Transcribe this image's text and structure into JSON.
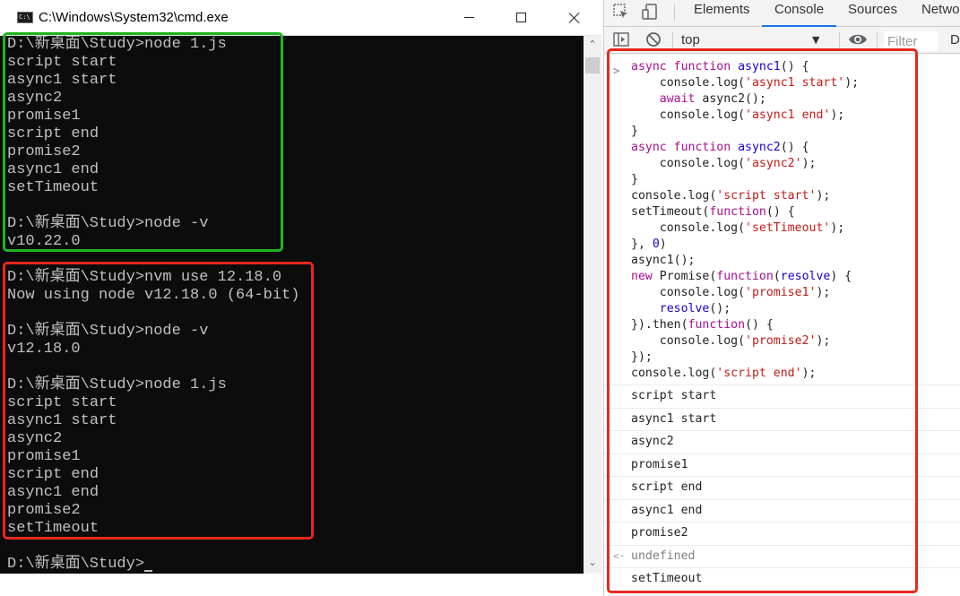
{
  "cmd_window": {
    "title": "C:\\Windows\\System32\\cmd.exe",
    "icon_label": "C:\\",
    "lines": [
      "D:\\新桌面\\Study>node 1.js",
      "script start",
      "async1 start",
      "async2",
      "promise1",
      "script end",
      "promise2",
      "async1 end",
      "setTimeout",
      "",
      "D:\\新桌面\\Study>node -v",
      "v10.22.0",
      "",
      "D:\\新桌面\\Study>nvm use 12.18.0",
      "Now using node v12.18.0 (64-bit)",
      "",
      "D:\\新桌面\\Study>node -v",
      "v12.18.0",
      "",
      "D:\\新桌面\\Study>node 1.js",
      "script start",
      "async1 start",
      "async2",
      "promise1",
      "script end",
      "async1 end",
      "promise2",
      "setTimeout",
      "",
      "D:\\新桌面\\Study>"
    ]
  },
  "devtools": {
    "tabs": [
      "Elements",
      "Console",
      "Sources",
      "Netwo"
    ],
    "active_tab": "Console",
    "toolbar": {
      "context": "top",
      "filter_placeholder": "Filter",
      "levels": "D"
    },
    "code_lines": [
      [
        [
          "kw",
          "async "
        ],
        [
          "kw",
          "function "
        ],
        [
          "fn",
          "async1"
        ],
        [
          "tok",
          "() {"
        ]
      ],
      [
        [
          "tok",
          "    console.log("
        ],
        [
          "str",
          "'async1 start'"
        ],
        [
          "tok",
          ");"
        ]
      ],
      [
        [
          "kw",
          "    await "
        ],
        [
          "tok",
          "async2();"
        ]
      ],
      [
        [
          "tok",
          "    console.log("
        ],
        [
          "str",
          "'async1 end'"
        ],
        [
          "tok",
          ");"
        ]
      ],
      [
        [
          "tok",
          "}"
        ]
      ],
      [
        [
          "kw",
          "async "
        ],
        [
          "kw",
          "function "
        ],
        [
          "fn",
          "async2"
        ],
        [
          "tok",
          "() {"
        ]
      ],
      [
        [
          "tok",
          "    console.log("
        ],
        [
          "str",
          "'async2'"
        ],
        [
          "tok",
          ");"
        ]
      ],
      [
        [
          "tok",
          "}"
        ]
      ],
      [
        [
          "tok",
          "console.log("
        ],
        [
          "str",
          "'script start'"
        ],
        [
          "tok",
          ");"
        ]
      ],
      [
        [
          "tok",
          "setTimeout("
        ],
        [
          "kw",
          "function"
        ],
        [
          "tok",
          "() {"
        ]
      ],
      [
        [
          "tok",
          "    console.log("
        ],
        [
          "str",
          "'setTimeout'"
        ],
        [
          "tok",
          ");"
        ]
      ],
      [
        [
          "tok",
          "}, "
        ],
        [
          "num",
          "0"
        ],
        [
          "tok",
          ")"
        ]
      ],
      [
        [
          "tok",
          "async1();"
        ]
      ],
      [
        [
          "kw",
          "new "
        ],
        [
          "tok",
          "Promise("
        ],
        [
          "kw",
          "function"
        ],
        [
          "tok",
          "("
        ],
        [
          "fn",
          "resolve"
        ],
        [
          "tok",
          ") {"
        ]
      ],
      [
        [
          "tok",
          "    console.log("
        ],
        [
          "str",
          "'promise1'"
        ],
        [
          "tok",
          ");"
        ]
      ],
      [
        [
          "fn",
          "    resolve"
        ],
        [
          "tok",
          "();"
        ]
      ],
      [
        [
          "tok",
          "}).then("
        ],
        [
          "kw",
          "function"
        ],
        [
          "tok",
          "() {"
        ]
      ],
      [
        [
          "tok",
          "    console.log("
        ],
        [
          "str",
          "'promise2'"
        ],
        [
          "tok",
          ");"
        ]
      ],
      [
        [
          "tok",
          "});"
        ]
      ],
      [
        [
          "tok",
          "console.log("
        ],
        [
          "str",
          "'script end'"
        ],
        [
          "tok",
          ");"
        ]
      ]
    ],
    "logs": [
      {
        "text": "script start",
        "kind": "log"
      },
      {
        "text": "async1 start",
        "kind": "log"
      },
      {
        "text": "async2",
        "kind": "log"
      },
      {
        "text": "promise1",
        "kind": "log"
      },
      {
        "text": "script end",
        "kind": "log"
      },
      {
        "text": "async1 end",
        "kind": "log"
      },
      {
        "text": "promise2",
        "kind": "log"
      },
      {
        "text": "undefined",
        "kind": "return"
      },
      {
        "text": "setTimeout",
        "kind": "log"
      }
    ]
  },
  "highlight_colors": {
    "green": "#1fb41f",
    "red": "#e8271c"
  }
}
